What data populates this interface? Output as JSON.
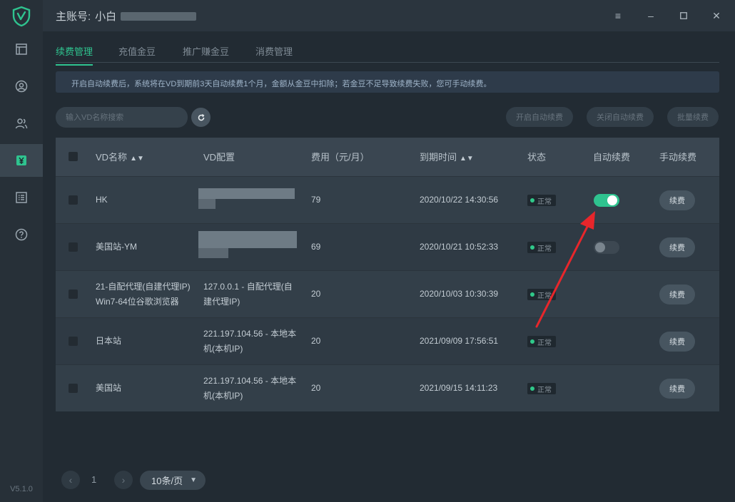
{
  "app": {
    "version": "V5.1.0",
    "account_label": "主账号:",
    "account_name": "小白",
    "window_controls": [
      "menu-icon",
      "minimize-icon",
      "maximize-icon",
      "close-icon"
    ],
    "accent_color": "#2fc38f"
  },
  "sidebar": {
    "items": [
      {
        "icon": "layout-icon",
        "active": false
      },
      {
        "icon": "user-circle-icon",
        "active": false
      },
      {
        "icon": "users-icon",
        "active": false
      },
      {
        "icon": "yen-icon",
        "active": true
      },
      {
        "icon": "list-icon",
        "active": false
      },
      {
        "icon": "help-icon",
        "active": false
      }
    ]
  },
  "tabs": [
    {
      "label": "续费管理",
      "active": true
    },
    {
      "label": "充值金豆",
      "active": false
    },
    {
      "label": "推广赚金豆",
      "active": false
    },
    {
      "label": "消费管理",
      "active": false
    }
  ],
  "notice": "开启自动续费后，系统将在VD到期前3天自动续费1个月，金额从金豆中扣除；若金豆不足导致续费失败，您可手动续费。",
  "search": {
    "placeholder": "输入VD名称搜索"
  },
  "actions": {
    "enable_auto": "开启自动续费",
    "disable_auto": "关闭自动续费",
    "batch_renew": "批量续费"
  },
  "table": {
    "headers": {
      "name": "VD名称",
      "config": "VD配置",
      "fee": "费用（元/月）",
      "expire": "到期时间",
      "status": "状态",
      "auto_renew": "自动续费",
      "manual_renew": "手动续费"
    },
    "rows": [
      {
        "name_line1": "HK",
        "name_line2": "",
        "config_line1": "",
        "config_line2": "",
        "config_blurred": true,
        "fee": "79",
        "expire": "2020/10/22 14:30:56",
        "status": "正常",
        "auto_renew": "on",
        "renew_label": "续费"
      },
      {
        "name_line1": "美国站-YM",
        "name_line2": "",
        "config_line1": "",
        "config_line2": "",
        "config_blurred": true,
        "fee": "69",
        "expire": "2020/10/21 10:52:33",
        "status": "正常",
        "auto_renew": "off",
        "renew_label": "续费"
      },
      {
        "name_line1": "21-自配代理(自建代理IP)",
        "name_line2": "Win7-64位谷歌浏览器",
        "config_line1": "127.0.0.1 - 自配代理(自",
        "config_line2": "建代理IP)",
        "config_blurred": false,
        "fee": "20",
        "expire": "2020/10/03 10:30:39",
        "status": "正常",
        "auto_renew": "none",
        "renew_label": "续费"
      },
      {
        "name_line1": "日本站",
        "name_line2": "",
        "config_line1": "221.197.104.56 - 本地本",
        "config_line2": "机(本机IP)",
        "config_blurred": false,
        "fee": "20",
        "expire": "2021/09/09 17:56:51",
        "status": "正常",
        "auto_renew": "none",
        "renew_label": "续费"
      },
      {
        "name_line1": "美国站",
        "name_line2": "",
        "config_line1": "221.197.104.56 - 本地本",
        "config_line2": "机(本机IP)",
        "config_blurred": false,
        "fee": "20",
        "expire": "2021/09/15 14:11:23",
        "status": "正常",
        "auto_renew": "none",
        "renew_label": "续费"
      }
    ]
  },
  "pagination": {
    "current_page": "1",
    "page_size": "10条/页"
  }
}
